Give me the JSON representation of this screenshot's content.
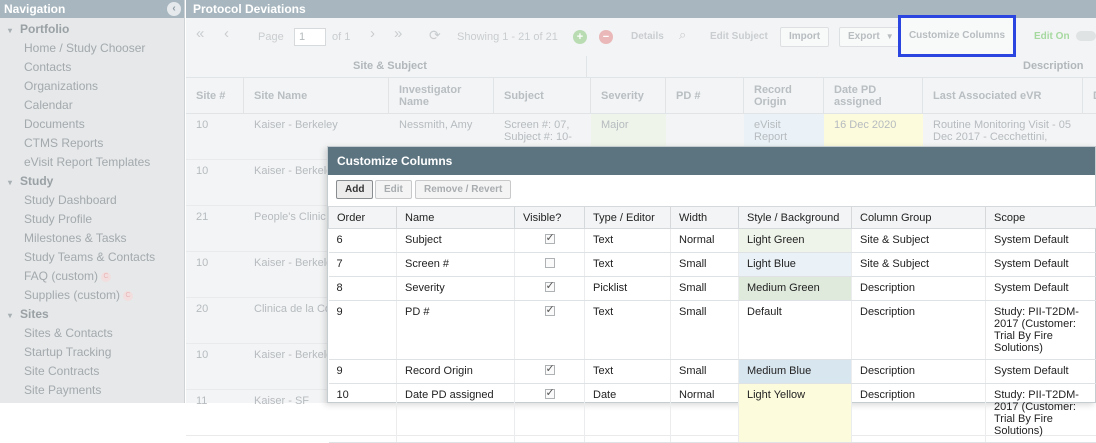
{
  "sidebar": {
    "title": "Navigation",
    "collapse_glyph": "‹",
    "sections": [
      {
        "label": "Portfolio",
        "items": [
          {
            "label": "Home / Study Chooser"
          },
          {
            "label": "Contacts"
          },
          {
            "label": "Organizations"
          },
          {
            "label": "Calendar"
          },
          {
            "label": "Documents"
          },
          {
            "label": "CTMS Reports"
          },
          {
            "label": "eVisit Report Templates"
          }
        ]
      },
      {
        "label": "Study",
        "items": [
          {
            "label": "Study Dashboard"
          },
          {
            "label": "Study Profile"
          },
          {
            "label": "Milestones & Tasks"
          },
          {
            "label": "Study Teams & Contacts"
          },
          {
            "label": "FAQ (custom)"
          },
          {
            "label": "Supplies (custom)"
          }
        ]
      },
      {
        "label": "Sites",
        "items": [
          {
            "label": "Sites & Contacts"
          },
          {
            "label": "Startup Tracking"
          },
          {
            "label": "Site Contracts"
          },
          {
            "label": "Site Payments"
          }
        ]
      }
    ],
    "custom_badge": "C"
  },
  "main": {
    "title": "Protocol Deviations",
    "toolbar": {
      "page_label": "Page",
      "page_value": "1",
      "of_label": "of 1",
      "showing": "Showing 1 - 21 of 21",
      "details": "Details",
      "edit_subject": "Edit Subject",
      "import": "Import",
      "export": "Export",
      "customize_columns": "Customize Columns",
      "edit_on": "Edit On"
    },
    "groups": {
      "site_subject": "Site & Subject",
      "description": "Description"
    },
    "headers": [
      "Site #",
      "Site Name",
      "Investigator Name",
      "Subject",
      "Severity",
      "PD #",
      "Record Origin",
      "Date PD assigned",
      "Last Associated eVR",
      "D"
    ],
    "rows": [
      {
        "site": "10",
        "name": "Kaiser - Berkeley",
        "inv": "Nessmith, Amy",
        "subject": "Screen #: 07, Subject #: 10-",
        "severity": "Major",
        "pd": "",
        "origin": "eVisit Report",
        "date": "16 Dec 2020",
        "evr": "Routine Monitoring Visit - 05 Dec 2017 - Cecchettini,"
      },
      {
        "site": "10",
        "name": "Kaiser - Berkeley"
      },
      {
        "site": "21",
        "name": "People's Clinic"
      },
      {
        "site": "10",
        "name": "Kaiser - Berkeley"
      },
      {
        "site": "20",
        "name": "Clinica de la Co"
      },
      {
        "site": "10",
        "name": "Kaiser - Berkeley"
      },
      {
        "site": "11",
        "name": "Kaiser - SF"
      }
    ]
  },
  "dialog": {
    "title": "Customize Columns",
    "buttons": {
      "add": "Add",
      "edit": "Edit",
      "remove": "Remove / Revert"
    },
    "columns": [
      "Order",
      "Name",
      "Visible?",
      "Type / Editor",
      "Width",
      "Style / Background",
      "Column Group",
      "Scope"
    ],
    "rows": [
      {
        "order": "6",
        "name": "Subject",
        "visible": true,
        "type": "Text",
        "width": "Normal",
        "style": "Light Green",
        "swatch": "#eef4ea",
        "group": "Site & Subject",
        "scope": "System Default"
      },
      {
        "order": "7",
        "name": "Screen #",
        "visible": false,
        "type": "Text",
        "width": "Small",
        "style": "Light Blue",
        "swatch": "#eaf2f7",
        "group": "Site & Subject",
        "scope": "System Default"
      },
      {
        "order": "8",
        "name": "Severity",
        "visible": true,
        "type": "Picklist",
        "width": "Small",
        "style": "Medium Green",
        "swatch": "#dfe9dc",
        "group": "Description",
        "scope": "System Default"
      },
      {
        "order": "9",
        "name": "PD #",
        "visible": true,
        "type": "Text",
        "width": "Small",
        "style": "Default",
        "swatch": "#ffffff",
        "group": "Description",
        "scope": "Study: PII-T2DM-2017 (Customer: Trial By Fire Solutions)"
      },
      {
        "order": "9",
        "name": "Record Origin",
        "visible": true,
        "type": "Text",
        "width": "Small",
        "style": "Medium Blue",
        "swatch": "#d8e6ef",
        "group": "Description",
        "scope": "System Default"
      },
      {
        "order": "10",
        "name": "Date PD assigned",
        "visible": true,
        "type": "Date",
        "width": "Normal",
        "style": "Light Yellow",
        "swatch": "#fcfbdc",
        "group": "Description",
        "scope": "Study: PII-T2DM-2017 (Customer: Trial By Fire Solutions)"
      }
    ]
  }
}
